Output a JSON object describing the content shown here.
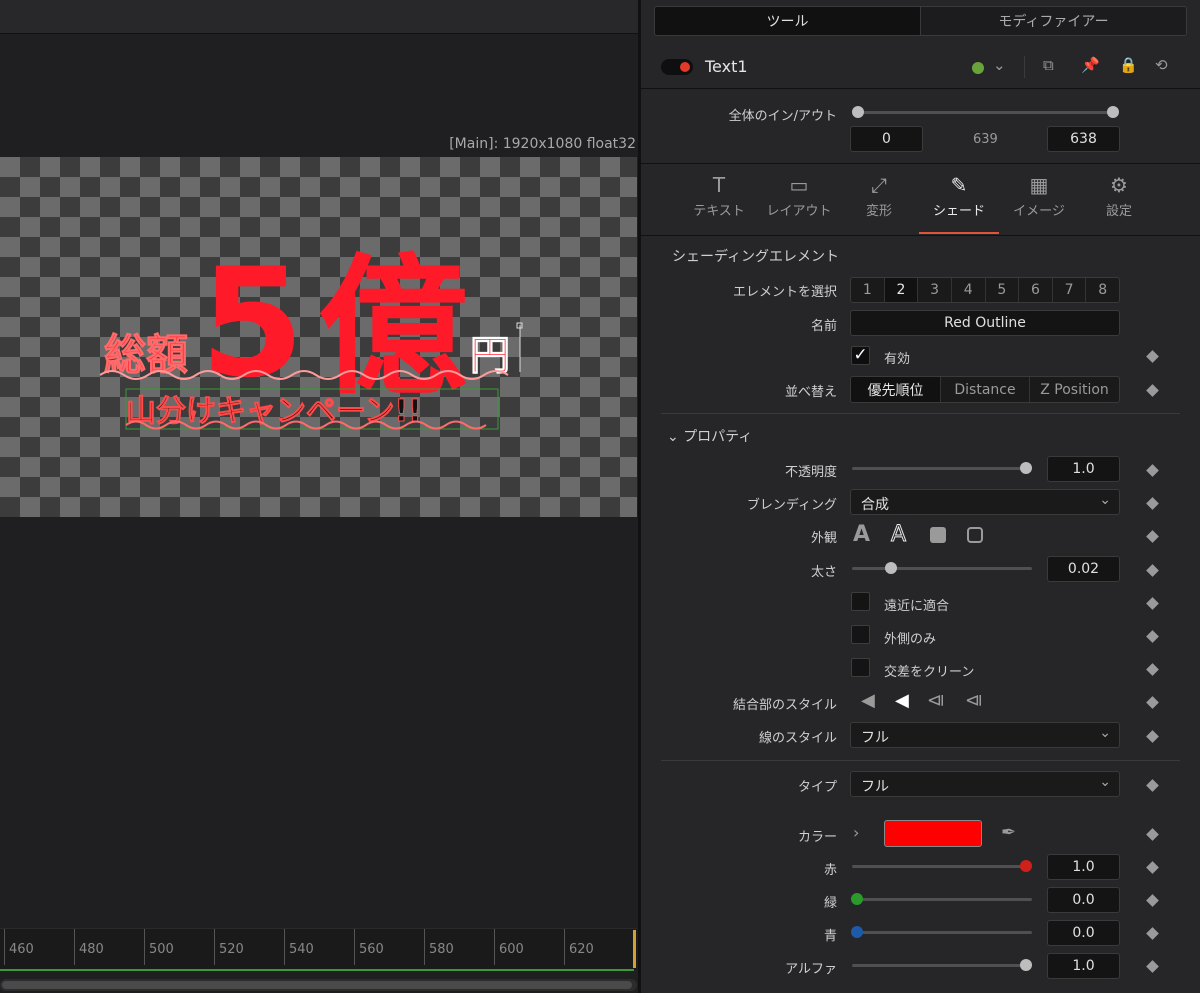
{
  "viewer": {
    "resolution_label": "[Main]: 1920x1080 float32"
  },
  "canvas_text": {
    "big_digit": "5",
    "big_kanji": "億",
    "small_left": "総額",
    "small_right": "円",
    "subtitle": "山分けキャンペーン!!"
  },
  "timeline": {
    "ticks": [
      "460",
      "480",
      "500",
      "520",
      "540",
      "560",
      "580",
      "600",
      "620"
    ]
  },
  "inspector": {
    "tabs_top": [
      "ツール",
      "モディファイアー"
    ],
    "node_title": "Text1",
    "inout_label": "全体のイン/アウト",
    "in_value": "0",
    "mid_value": "639",
    "out_value": "638",
    "tool_tabs": [
      "テキスト",
      "レイアウト",
      "変形",
      "シェード",
      "イメージ",
      "設定"
    ],
    "section_title": "シェーディングエレメント",
    "element_select_label": "エレメントを選択",
    "element_numbers": [
      "1",
      "2",
      "3",
      "4",
      "5",
      "6",
      "7",
      "8"
    ],
    "name_label": "名前",
    "name_value": "Red Outline",
    "enabled_label": "有効",
    "sort_label": "並べ替え",
    "sort_options": [
      "優先順位",
      "Distance",
      "Z Position"
    ],
    "properties_header": "プロパティ",
    "opacity_label": "不透明度",
    "opacity_value": "1.0",
    "blending_label": "ブレンディング",
    "blending_value": "合成",
    "appearance_label": "外観",
    "thickness_label": "太さ",
    "thickness_value": "0.02",
    "opt1": "遠近に適合",
    "opt2": "外側のみ",
    "opt3": "交差をクリーン",
    "join_style_label": "結合部のスタイル",
    "line_style_label": "線のスタイル",
    "line_style_value": "フル",
    "type_label": "タイプ",
    "type_value": "フル",
    "color_label": "カラー",
    "color_hex": "#ff0000",
    "red_label": "赤",
    "red_value": "1.0",
    "green_label": "緑",
    "green_value": "0.0",
    "blue_label": "青",
    "blue_value": "0.0",
    "alpha_label": "アルファ",
    "alpha_value": "1.0"
  }
}
